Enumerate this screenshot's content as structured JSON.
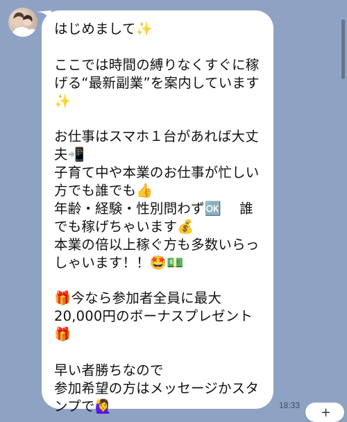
{
  "message": {
    "lines": [
      "はじめまして✨",
      "",
      "ここでは時間の縛りなくすぐに稼",
      "げる“最新副業”を案内しています",
      "✨",
      "",
      "お仕事はスマホ１台があれば大丈",
      "夫📲",
      "子育て中や本業のお仕事が忙しい",
      "方でも誰でも👍",
      "年齢・経験・性別問わず🆗　 誰",
      "でも稼げちゃいます💰",
      "本業の倍以上稼ぐ方も多数いらっ",
      "しゃいます！！🤩💵",
      "",
      "🎁今なら参加者全員に最大",
      "20,000円のボーナスプレゼント",
      "🎁",
      "",
      "早い者勝ちなので",
      "参加希望の方はメッセージかスタ",
      "ンプで🙋‍♀️"
    ],
    "timestamp": "18:33"
  },
  "icons": {
    "avatar": "profile-photo-icon",
    "action": "plus-icon"
  },
  "colors": {
    "background": "#8ea3c4",
    "bubble": "#ffffff",
    "text": "#111111"
  }
}
